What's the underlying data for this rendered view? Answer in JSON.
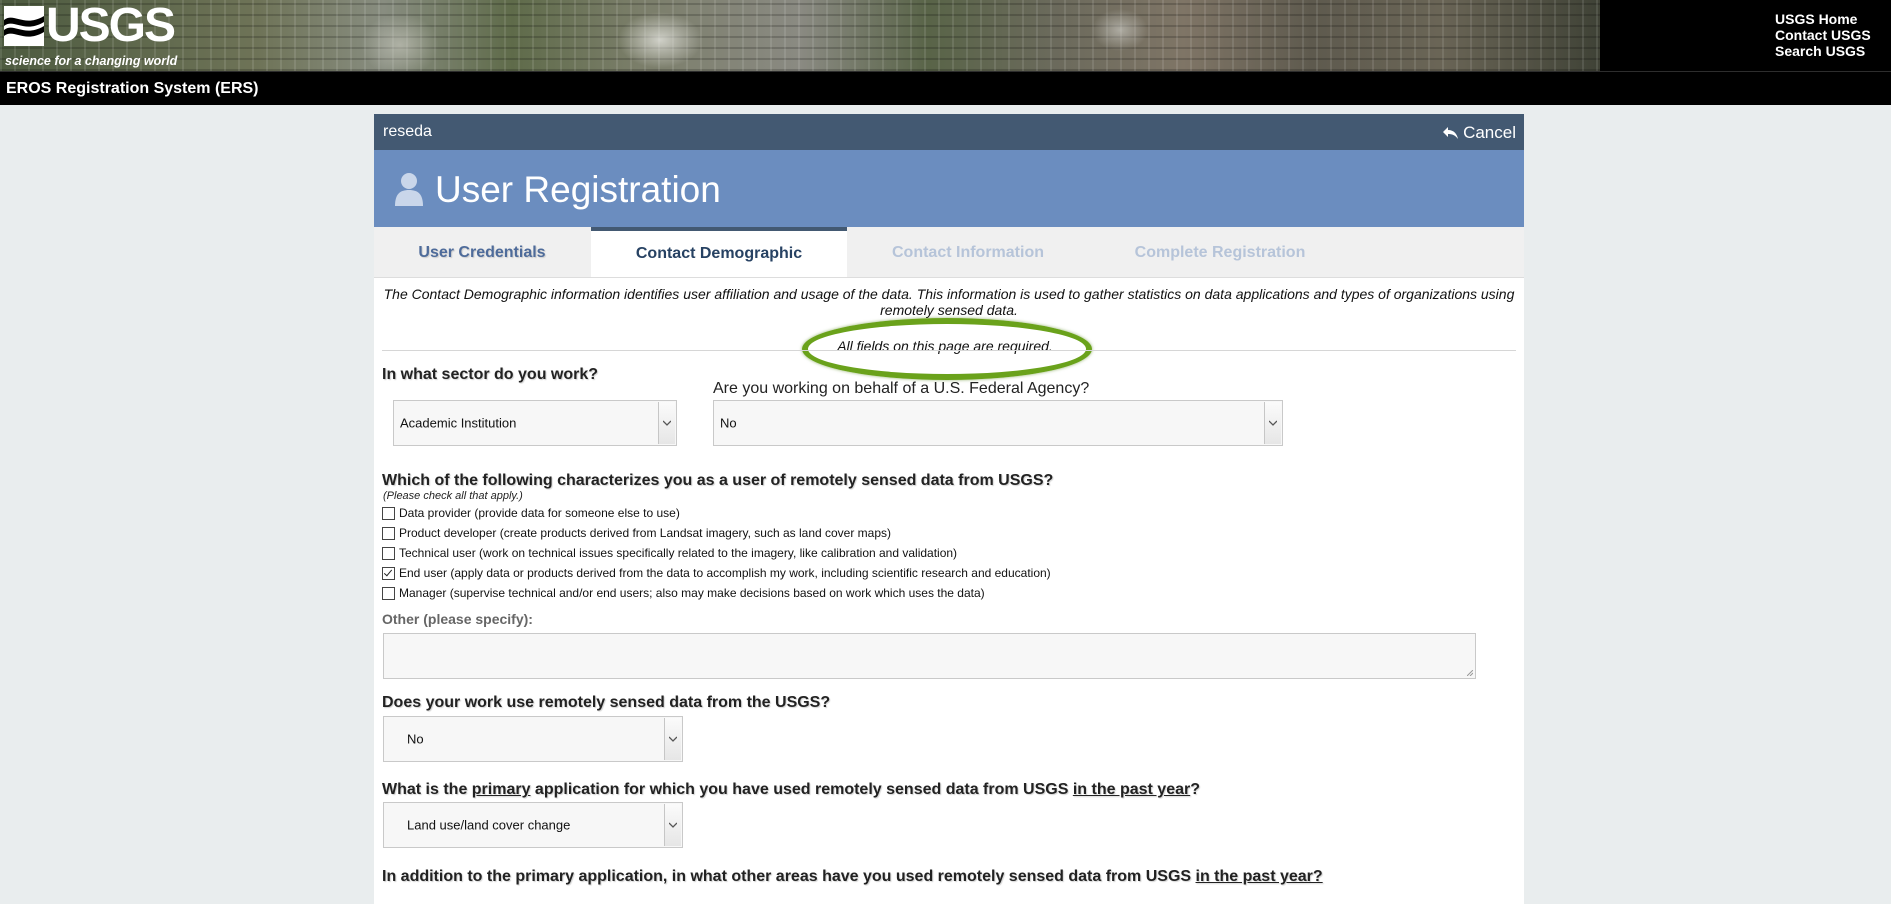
{
  "header": {
    "logo_text": "USGS",
    "tagline": "science for a changing world",
    "links": [
      "USGS Home",
      "Contact USGS",
      "Search USGS"
    ],
    "system_title": "EROS Registration System (ERS)"
  },
  "panel": {
    "username": "reseda",
    "cancel_label": "Cancel",
    "title": "User Registration",
    "tabs": [
      {
        "label": "User Credentials",
        "state": "completed"
      },
      {
        "label": "Contact Demographic",
        "state": "active"
      },
      {
        "label": "Contact Information",
        "state": "disabled"
      },
      {
        "label": "Complete Registration",
        "state": "disabled"
      }
    ]
  },
  "form": {
    "intro": "The Contact Demographic information identifies user affiliation and usage of the data. This information is used to gather statistics on data applications and types of organizations using remotely sensed data.",
    "required_note": "All fields on this page are required.",
    "sector": {
      "question": "In what sector do you work?",
      "value": "Academic Institution"
    },
    "federal": {
      "question": "Are you working on behalf of a U.S. Federal Agency?",
      "value": "No"
    },
    "user_type": {
      "question": "Which of the following characterizes you as a user of remotely sensed data from USGS?",
      "hint": "(Please check all that apply.)",
      "options": [
        {
          "label": "Data provider (provide data for someone else to use)",
          "checked": false
        },
        {
          "label": "Product developer (create products derived from Landsat imagery, such as land cover maps)",
          "checked": false
        },
        {
          "label": "Technical user (work on technical issues specifically related to the imagery, like calibration and validation)",
          "checked": false
        },
        {
          "label": "End user (apply data or products derived from the data to accomplish my work, including scientific research and education)",
          "checked": true
        },
        {
          "label": "Manager (supervise technical and/or end users; also may make decisions based on work which uses the data)",
          "checked": false
        }
      ],
      "other_label": "Other (please specify):",
      "other_value": ""
    },
    "usgs_data": {
      "question": "Does your work use remotely sensed data from the USGS?",
      "value": "No"
    },
    "primary_app": {
      "q_before": "What is the ",
      "q_primary": "primary",
      "q_middle": " application for which you have used remotely sensed data from USGS ",
      "q_past": "in the past year",
      "q_end": "?",
      "value": "Land use/land cover change"
    },
    "other_areas": {
      "q_before": "In addition to the primary application, in what other areas have you used remotely sensed data from USGS ",
      "q_past": "in the past year?"
    }
  },
  "colors": {
    "panel_topbar": "#435972",
    "panel_titlebar": "#6b8dbf",
    "required_ring": "#6aa21b"
  }
}
